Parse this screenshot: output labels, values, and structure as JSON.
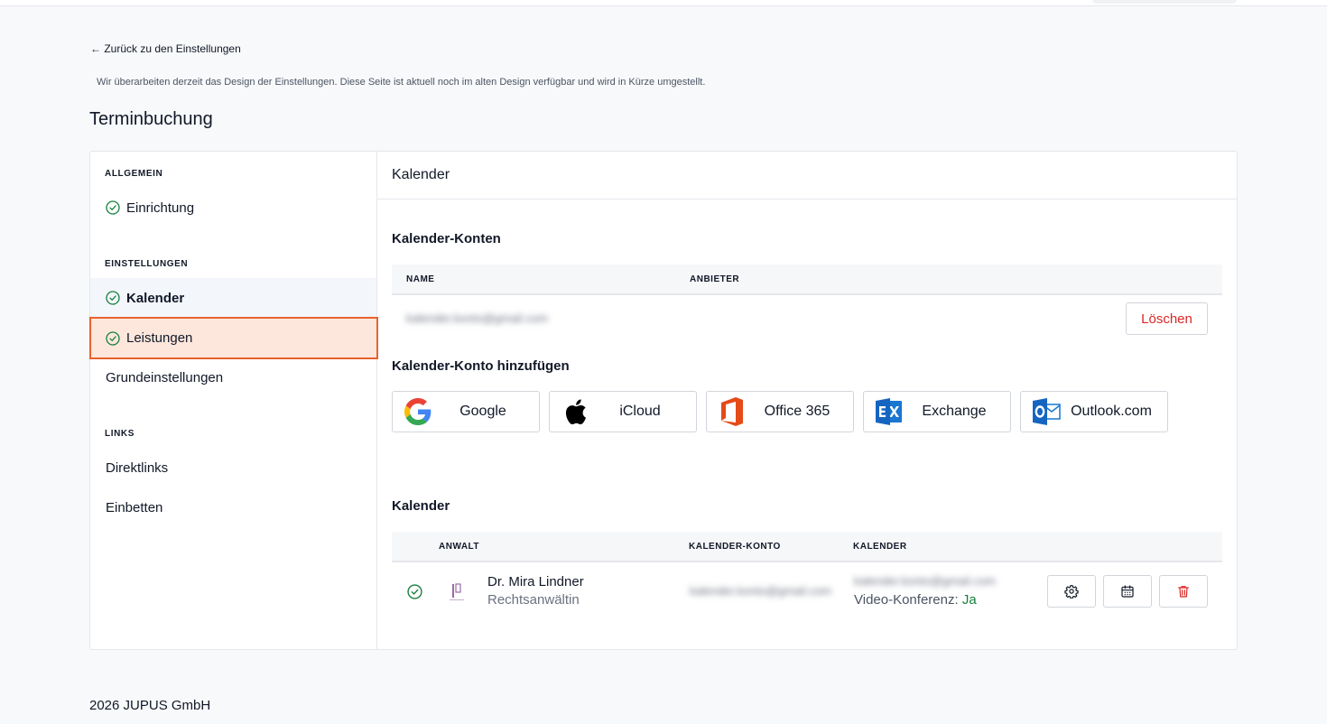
{
  "nav": {
    "back_label": "← Zurück zu den Einstellungen",
    "notice": "Wir überarbeiten derzeit das Design der Einstellungen. Diese Seite ist aktuell noch im alten Design verfügbar und wird in Kürze umgestellt.",
    "page_title": "Terminbuchung"
  },
  "sidebar": {
    "sections": [
      {
        "heading": "ALLGEMEIN",
        "items": [
          {
            "label": "Einrichtung",
            "checked": true
          }
        ]
      },
      {
        "heading": "EINSTELLUNGEN",
        "items": [
          {
            "label": "Kalender",
            "checked": true,
            "active": true
          },
          {
            "label": "Leistungen",
            "checked": true,
            "hovered": true
          },
          {
            "label": "Grundeinstellungen",
            "checked": false
          }
        ]
      },
      {
        "heading": "LINKS",
        "items": [
          {
            "label": "Direktlinks",
            "checked": false
          },
          {
            "label": "Einbetten",
            "checked": false
          }
        ]
      }
    ]
  },
  "main": {
    "header": "Kalender",
    "accounts": {
      "title": "Kalender-Konten",
      "columns": [
        "NAME",
        "ANBIETER"
      ],
      "rows": [
        {
          "name": "kalender.konto@gmail.com",
          "provider": "",
          "delete_label": "Löschen"
        }
      ]
    },
    "add_account": {
      "title": "Kalender-Konto hinzufügen",
      "providers": [
        {
          "name": "Google",
          "icon": "google-icon"
        },
        {
          "name": "iCloud",
          "icon": "apple-icon"
        },
        {
          "name": "Office 365",
          "icon": "office365-icon"
        },
        {
          "name": "Exchange",
          "icon": "exchange-icon"
        },
        {
          "name": "Outlook.com",
          "icon": "outlook-icon"
        }
      ]
    },
    "calendars": {
      "title": "Kalender",
      "columns": [
        "ANWALT",
        "KALENDER-KONTO",
        "KALENDER"
      ],
      "rows": [
        {
          "checked": true,
          "name": "Dr. Mira Lindner",
          "role": "Rechtsanwältin",
          "account": "kalender.konto@gmail.com",
          "calendar": "kalender.konto@gmail.com",
          "video_label": "Video-Konferenz:",
          "video_value": "Ja",
          "actions": [
            "gear-icon",
            "calendar-icon",
            "trash-icon"
          ]
        }
      ]
    }
  },
  "footer": "2026 JUPUS GmbH",
  "colors": {
    "accent": "#e8632d",
    "success": "#15803d",
    "danger": "#dc2626"
  }
}
